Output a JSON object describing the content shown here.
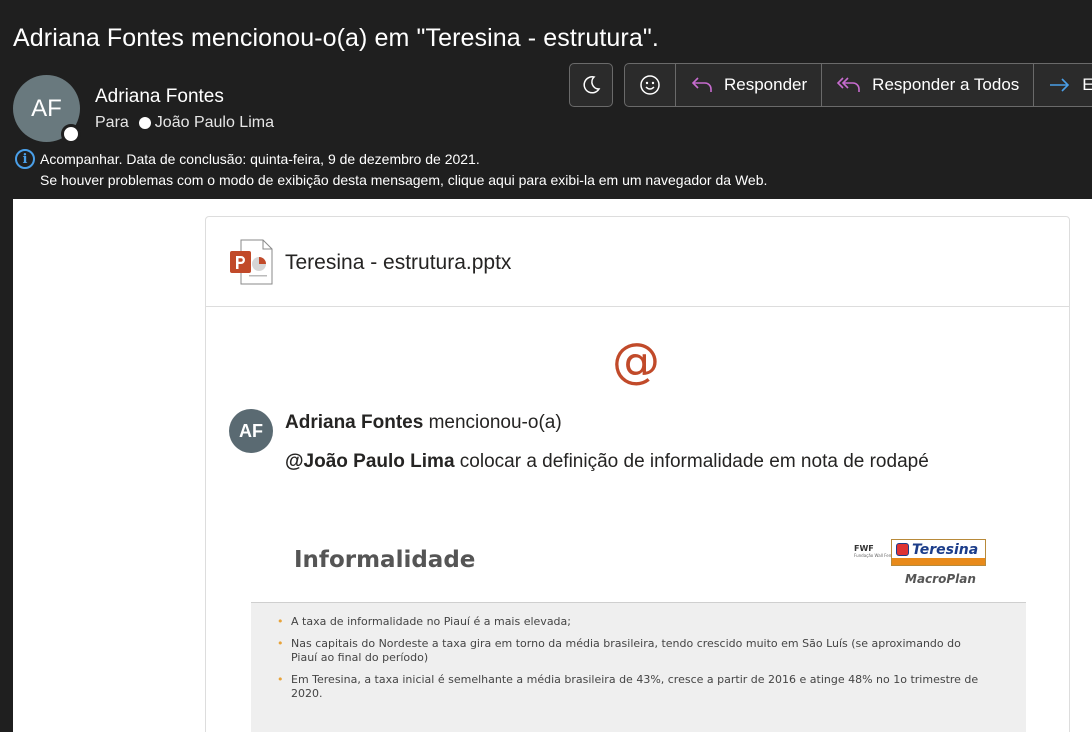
{
  "subject": "Adriana Fontes mencionou-o(a) em \"Teresina - estrutura\".",
  "sender": {
    "initials": "AF",
    "name": "Adriana Fontes",
    "to_label": "Para",
    "to_name": "João Paulo Lima"
  },
  "toolbar": {
    "reply": "Responder",
    "reply_all": "Responder a Todos",
    "forward": "En"
  },
  "info": {
    "line1": "Acompanhar.  Data de conclusão: quinta-feira, 9 de dezembro de 2021.",
    "line2": "Se houver problemas com o modo de exibição desta mensagem, clique aqui para exibi-la em um navegador da Web."
  },
  "card": {
    "file_name": "Teresina - estrutura.pptx",
    "at_symbol": "@",
    "mention": {
      "initials": "AF",
      "author": "Adriana Fontes",
      "action": "mencionou-o(a)",
      "target": "@João Paulo Lima",
      "text": "colocar a definição de informalidade em nota de rodapé"
    },
    "slide": {
      "title": "Informalidade",
      "bullets": [
        "A taxa de informalidade no Piauí é a mais elevada;",
        "Nas capitais do Nordeste a taxa gira em torno da média brasileira, tendo crescido muito em São Luís (se aproximando do Piauí ao final do período)",
        "Em Teresina, a taxa inicial é semelhante a média brasileira de 43%, cresce a partir de 2016 e atinge 48% no 1o trimestre de 2020."
      ],
      "logo_fwf": "FWF",
      "logo_fwf_sub": "Fundação Wall Ferraz",
      "logo_teresina": "Teresina",
      "logo_macroplan": "MacroPlan"
    }
  },
  "colors": {
    "background": "#1f1f1f",
    "accent_at": "#c14a2a",
    "reply_icon": "#c76ccf",
    "forward_icon": "#4a9fe8",
    "info_icon": "#4a9fe8"
  }
}
